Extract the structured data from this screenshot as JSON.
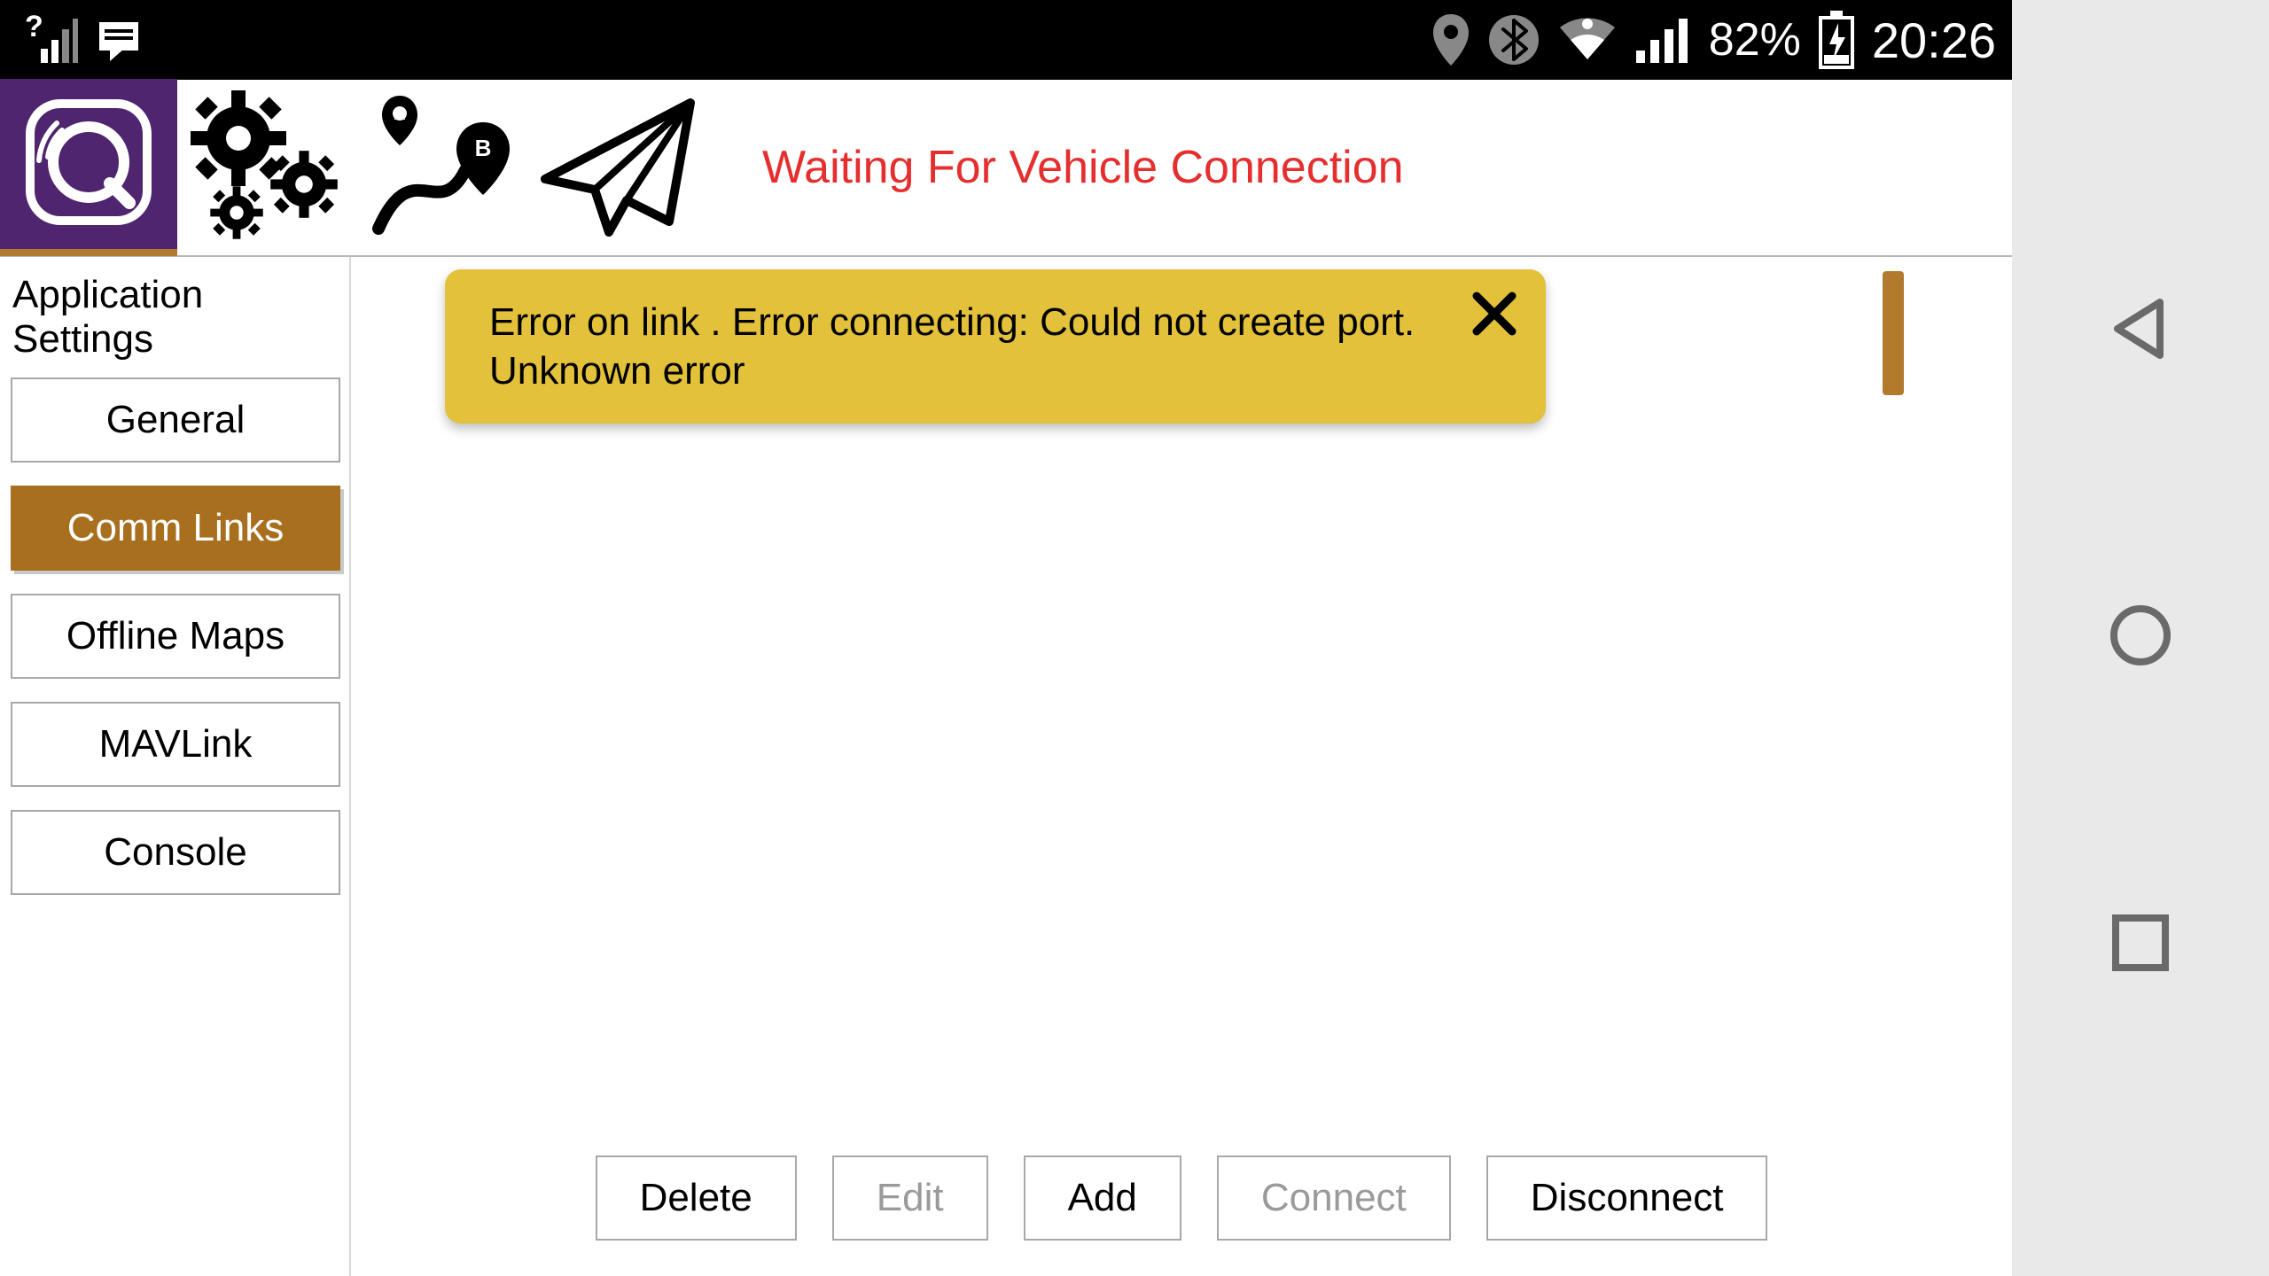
{
  "status_bar": {
    "battery": "82%",
    "time": "20:26"
  },
  "toolbar": {
    "status": "Waiting For Vehicle Connection"
  },
  "sidebar": {
    "title": "Application Settings",
    "items": [
      {
        "label": "General"
      },
      {
        "label": "Comm Links"
      },
      {
        "label": "Offline Maps"
      },
      {
        "label": "MAVLink"
      },
      {
        "label": "Console"
      }
    ],
    "active_index": 1
  },
  "alert": {
    "message": "Error on link . Error connecting: Could not create port. Unknown error"
  },
  "buttons": {
    "delete": "Delete",
    "edit": "Edit",
    "add": "Add",
    "connect": "Connect",
    "disconnect": "Disconnect"
  }
}
